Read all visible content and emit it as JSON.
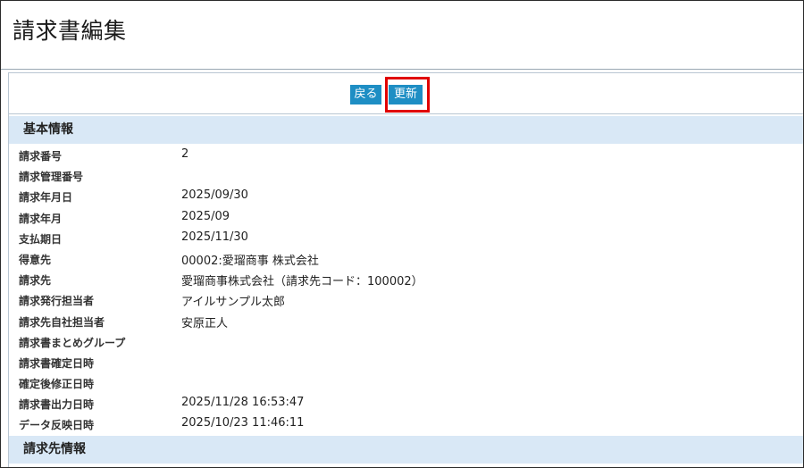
{
  "page": {
    "title": "請求書編集"
  },
  "toolbar": {
    "back_label": "戻る",
    "update_label": "更新"
  },
  "sections": {
    "basic_info": "基本情報",
    "billing_info": "請求先情報"
  },
  "fields": [
    {
      "label": "請求番号",
      "value": "2"
    },
    {
      "label": "請求管理番号",
      "value": ""
    },
    {
      "label": "請求年月日",
      "value": "2025/09/30"
    },
    {
      "label": "請求年月",
      "value": "2025/09"
    },
    {
      "label": "支払期日",
      "value": "2025/11/30"
    },
    {
      "label": "得意先",
      "value": "00002:愛瑠商事 株式会社"
    },
    {
      "label": "請求先",
      "value": "愛瑠商事株式会社（請求先コード：100002）"
    },
    {
      "label": "請求発行担当者",
      "value": "アイルサンプル太郎"
    },
    {
      "label": "請求先自社担当者",
      "value": "安原正人"
    },
    {
      "label": "請求書まとめグループ",
      "value": ""
    },
    {
      "label": "請求書確定日時",
      "value": ""
    },
    {
      "label": "確定後修正日時",
      "value": ""
    },
    {
      "label": "請求書出力日時",
      "value": "2025/11/28 16:53:47"
    },
    {
      "label": "データ反映日時",
      "value": "2025/10/23 11:46:11"
    }
  ],
  "colors": {
    "button": "#1e8ec4",
    "section_bg": "#d9e8f6",
    "highlight": "#e00000"
  }
}
